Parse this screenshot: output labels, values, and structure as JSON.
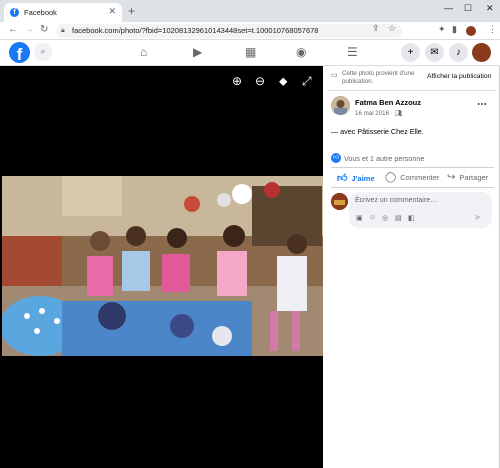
{
  "browser": {
    "tab_title": "Facebook",
    "tab_close": "✕",
    "new_tab": "+",
    "window_controls": {
      "minimize": "—",
      "maximize": "☐",
      "close": "✕"
    },
    "url": "facebook.com/photo/?fbid=102081329610143448set=t.100010768057678",
    "nav_icons": [
      "back-arrow-icon",
      "forward-arrow-icon",
      "reload-icon"
    ]
  },
  "facebook_nav": {
    "logo": "f",
    "search_icon": "search-icon",
    "center_icons": [
      "home-icon",
      "watch-icon",
      "marketplace-icon",
      "groups-icon",
      "menu-icon"
    ],
    "right_icons": [
      "create-icon",
      "messenger-icon",
      "notifications-icon",
      "profile-icon"
    ]
  },
  "viewer": {
    "tools": [
      "zoom-in-icon",
      "zoom-out-icon",
      "tag-icon",
      "fullscreen-icon"
    ]
  },
  "panel": {
    "hint_text": "Cette photo provient d'une publication.",
    "show_publication": "Afficher la publication",
    "author": "Fatma Ben Azzouz",
    "date": "16 mai 2016 ·",
    "caption": "— avec Pâtisserie Chez Elle.",
    "reactions": "Vous et 1 autre personne",
    "actions": {
      "like": "J'aime",
      "comment": "Commenter",
      "share": "Partager"
    },
    "comment_placeholder": "Écrivez un commentaire…"
  },
  "colors": {
    "brand_blue": "#1877f2",
    "like_active": "#1877f2",
    "viewer_bg": "#000000"
  }
}
